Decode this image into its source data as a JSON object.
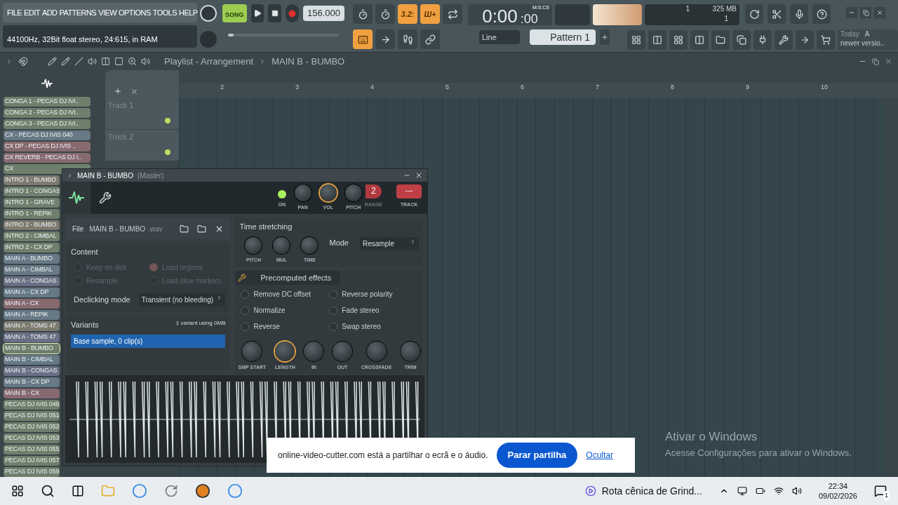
{
  "menu": [
    "FILE",
    "EDIT",
    "ADD",
    "PATTERNS",
    "VIEW",
    "OPTIONS",
    "TOOLS",
    "HELP"
  ],
  "hint": "44100Hz, 32Bit float stereo, 24:615, in RAM",
  "transport": {
    "mode_label": "SONG",
    "song_mode": true,
    "recording": false,
    "tempo": "156.000",
    "time_main": "0:00",
    "time_cs": ":00",
    "position": {
      "level": 0
    },
    "time_format": "M:S:CS"
  },
  "toolbar_top": [
    {
      "kind": "metronome",
      "on": false
    },
    {
      "kind": "countdown",
      "on": false
    },
    {
      "kind": "typing",
      "label": "3.2:",
      "on": true
    },
    {
      "kind": "step",
      "label": "Ш+",
      "on": true
    },
    {
      "kind": "loop",
      "on": false
    }
  ],
  "cpu": {
    "voices": "1",
    "memory": "325 MB",
    "polyphony": "1"
  },
  "toolbar_bottom": [
    {
      "kind": "keyboard",
      "on": true
    },
    {
      "kind": "arrow",
      "on": false
    },
    {
      "kind": "foot",
      "on": false
    },
    {
      "kind": "link",
      "on": false
    }
  ],
  "snap": "Line",
  "pattern": "Pattern 1",
  "news": {
    "date": "Today",
    "lines": [
      "A",
      "newer versio.."
    ]
  },
  "playlist": {
    "title": "Playlist - Arrangement",
    "pattern": "MAIN B - BUMBO",
    "ruler": [
      "2",
      "3",
      "4",
      "5",
      "6",
      "7",
      "8",
      "9",
      "10"
    ],
    "tracks": [
      {
        "name": "Track 1"
      },
      {
        "name": "Track 2"
      }
    ]
  },
  "channels": [
    {
      "name": "CONGA 1 - PECAS DJ IVI..",
      "color": "#6f7f6c",
      "selected": false
    },
    {
      "name": "CONGA 2 - PECAS DJ IVI..",
      "color": "#6f7f6c",
      "selected": false
    },
    {
      "name": "CONGA 3 - PECAS DJ IVI..",
      "color": "#6f7f6c",
      "selected": false
    },
    {
      "name": "CX - PECAS DJ IVIS  040",
      "color": "#667985",
      "selected": false
    },
    {
      "name": "CX DP - PECAS DJ IVIS ..",
      "color": "#866a70",
      "selected": false
    },
    {
      "name": "CX REVERB - PECAS DJ I..",
      "color": "#866a70",
      "selected": false
    },
    {
      "name": "CX",
      "color": "#6f7f6c",
      "selected": false
    },
    {
      "name": "INTRO 1 - BUMBO",
      "color": "#7d7a70",
      "selected": false
    },
    {
      "name": "INTRO 1 - CONGAS",
      "color": "#6f7f6c",
      "selected": false
    },
    {
      "name": "INTRO 1 - GRAVE",
      "color": "#6f7f6c",
      "selected": false
    },
    {
      "name": "INTRO 1 - REPIK",
      "color": "#6f7f6c",
      "selected": false
    },
    {
      "name": "INTRO 2 - BUMBO",
      "color": "#7d7a70",
      "selected": false
    },
    {
      "name": "INTRO 2 - CIMBAL",
      "color": "#6f7f6c",
      "selected": false
    },
    {
      "name": "INTRO 2 - CX DP",
      "color": "#6f7f6c",
      "selected": false
    },
    {
      "name": "MAIN A - BUMBO",
      "color": "#667985",
      "selected": false
    },
    {
      "name": "MAIN A - CIMBAL",
      "color": "#667985",
      "selected": false
    },
    {
      "name": "MAIN A - CONGAS",
      "color": "#6a6f85",
      "selected": false
    },
    {
      "name": "MAIN A - CX DP",
      "color": "#667985",
      "selected": false
    },
    {
      "name": "MAIN A - CX",
      "color": "#866a70",
      "selected": false
    },
    {
      "name": "MAIN A - REPIK",
      "color": "#667985",
      "selected": false
    },
    {
      "name": "MAIN A - TOMS 47",
      "color": "#7d7a70",
      "selected": false
    },
    {
      "name": "MAIN A - TOMS 47",
      "color": "#6a6f85",
      "selected": false
    },
    {
      "name": "MAIN B - BUMBO",
      "color": "#6f7f6c",
      "selected": true
    },
    {
      "name": "MAIN B - CIMBAL",
      "color": "#667985",
      "selected": false
    },
    {
      "name": "MAIN B - CONGAS",
      "color": "#6a6f85",
      "selected": false
    },
    {
      "name": "MAIN B - CX DP",
      "color": "#667985",
      "selected": false
    },
    {
      "name": "MAIN B - CX",
      "color": "#866a70",
      "selected": false
    },
    {
      "name": "PECAS DJ IVIS  049",
      "color": "#6f7f6c",
      "selected": false
    },
    {
      "name": "PECAS DJ IVIS  051",
      "color": "#6f7f6c",
      "selected": false
    },
    {
      "name": "PECAS DJ IVIS  052",
      "color": "#6f7f6c",
      "selected": false
    },
    {
      "name": "PECAS DJ IVIS  053",
      "color": "#6f7f6c",
      "selected": false
    },
    {
      "name": "PECAS DJ IVIS  055",
      "color": "#6f7f6c",
      "selected": false
    },
    {
      "name": "PECAS DJ IVIS  057",
      "color": "#6f7f6c",
      "selected": false
    },
    {
      "name": "PECAS DJ IVIS  059",
      "color": "#6f7f6c",
      "selected": false
    }
  ],
  "channel_window": {
    "title": "MAIN B - BUMBO",
    "subtitle": "(Master)",
    "on": true,
    "knobs": [
      {
        "label": "PAN",
        "focused": false
      },
      {
        "label": "VOL",
        "focused": true
      },
      {
        "label": "PITCH",
        "focused": false
      }
    ],
    "range_label": "RANGE",
    "range": "2",
    "track_label": "TRACK",
    "track": "---",
    "on_label": "ON",
    "file_label": "File",
    "file_name": "MAIN B - BUMBO",
    "file_ext": ".wav",
    "content_title": "Content",
    "content_options": [
      {
        "label": "Keep on disk",
        "checked": false
      },
      {
        "label": "Load regions",
        "checked": true
      },
      {
        "label": "Resample",
        "checked": false
      },
      {
        "label": "Load slice markers",
        "checked": false
      }
    ],
    "declicking_label": "Declicking mode",
    "declicking": "Transient (no bleeding)",
    "variants_title": "Variants",
    "variants_info": "1 variant using 0MB",
    "variants": [
      {
        "label": "Base sample, 0 clip(s)",
        "selected": true
      }
    ],
    "stretch_title": "Time stretching",
    "stretch_knobs": [
      {
        "label": "PITCH",
        "focused": false
      },
      {
        "label": "MUL",
        "focused": false
      },
      {
        "label": "TIME",
        "focused": false
      }
    ],
    "mode_label": "Mode",
    "mode": "Resample",
    "effects_title": "Precomputed effects",
    "effects": [
      {
        "label": "Remove DC offset",
        "checked": false
      },
      {
        "label": "Reverse polarity",
        "checked": false
      },
      {
        "label": "Normalize",
        "checked": false
      },
      {
        "label": "Fade stereo",
        "checked": false
      },
      {
        "label": "Reverse",
        "checked": false
      },
      {
        "label": "Swap stereo",
        "checked": false
      }
    ],
    "bottom_knobs": [
      {
        "label": "SMP START",
        "focused": false
      },
      {
        "label": "LENGTH",
        "focused": true
      },
      {
        "label": "IN",
        "focused": false
      },
      {
        "label": "OUT",
        "focused": false
      },
      {
        "label": "CROSSFADE",
        "focused": false
      },
      {
        "label": "TRIM",
        "focused": false
      }
    ]
  },
  "share_bar": {
    "message": "online-video-cutter.com está a partilhar o ecrã e o áudio.",
    "stop": "Parar partilha",
    "hide": "Ocultar"
  },
  "activation": {
    "title": "Ativar o Windows",
    "text": "Acesse Configurações para ativar o Windows."
  },
  "taskbar": {
    "media": "Rota cênica de Grind...",
    "time": "22:34",
    "date": "09/02/2026",
    "notifications": "1"
  }
}
